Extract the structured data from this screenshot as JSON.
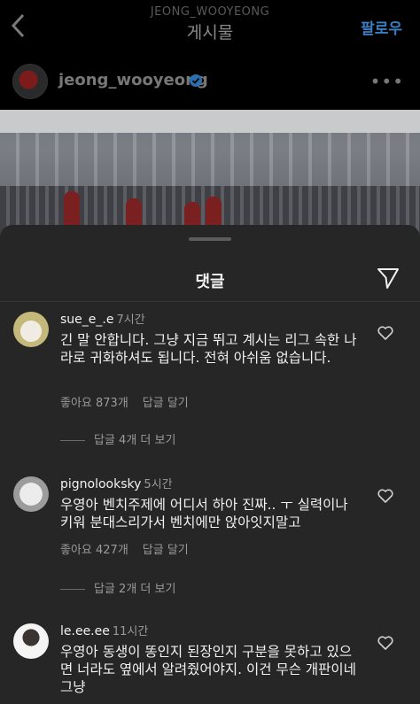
{
  "header": {
    "username_small": "JEONG_WOOYEONG",
    "title": "게시물",
    "follow_label": "팔로우"
  },
  "post": {
    "username": "jeong_wooyeong",
    "verified": true,
    "more": "•••"
  },
  "comments_sheet": {
    "title": "댓글",
    "comments": [
      {
        "user": "sue_e_.e",
        "time": "7시간",
        "text": "긴 말 안합니다. 그냥 지금 뛰고 계시는 리그 속한 나라로 귀화하셔도 됩니다. 전혀 아쉬움 없습니다.",
        "likes": "좋아요 873개",
        "reply": "답글 달기",
        "view_replies": "답글 4개 더 보기"
      },
      {
        "user": "pignolooksky",
        "time": "5시간",
        "text": "우영아 벤치주제에 어디서 하아 진짜.. ㅜ 실력이나 키워 분대스리가서 벤치에만 앉아잇지말고",
        "likes": "좋아요 427개",
        "reply": "답글 달기",
        "view_replies": "답글 2개 더 보기"
      },
      {
        "user": "le.ee.ee",
        "time": "11시간",
        "text": "우영아 동생이 똥인지 된장인지 구분을 못하고 있으면 너라도 옆에서 알려줬어야지. 이건 무슨 개판이네 그냥"
      }
    ]
  },
  "colors": {
    "background": "#000000",
    "sheet": "#262626",
    "follow": "#3a7ec2",
    "muted": "#9a9a9a"
  }
}
